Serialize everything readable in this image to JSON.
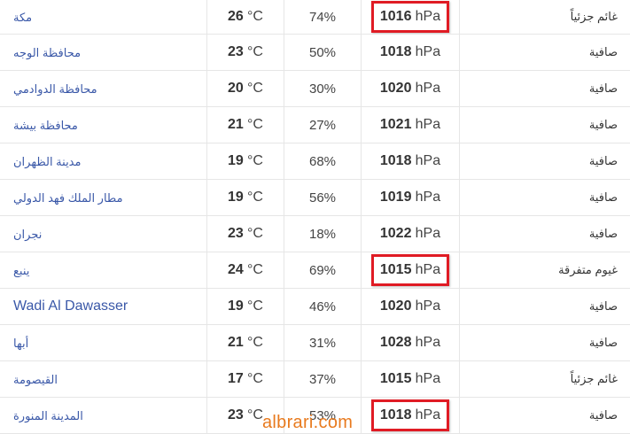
{
  "table": {
    "rows": [
      {
        "city": "مكة",
        "temp": "26",
        "temp_unit": "°C",
        "humidity": "74%",
        "pressure": "1016",
        "pressure_unit": "hPa",
        "condition": "غائم جزئياً",
        "highlighted": true
      },
      {
        "city": "محافظة الوجه",
        "temp": "23",
        "temp_unit": "°C",
        "humidity": "50%",
        "pressure": "1018",
        "pressure_unit": "hPa",
        "condition": "صافية",
        "highlighted": false
      },
      {
        "city": "محافظة الدوادمي",
        "temp": "20",
        "temp_unit": "°C",
        "humidity": "30%",
        "pressure": "1020",
        "pressure_unit": "hPa",
        "condition": "صافية",
        "highlighted": false
      },
      {
        "city": "محافظة بيشة",
        "temp": "21",
        "temp_unit": "°C",
        "humidity": "27%",
        "pressure": "1021",
        "pressure_unit": "hPa",
        "condition": "صافية",
        "highlighted": false
      },
      {
        "city": "مدينة الظهران",
        "temp": "19",
        "temp_unit": "°C",
        "humidity": "68%",
        "pressure": "1018",
        "pressure_unit": "hPa",
        "condition": "صافية",
        "highlighted": false
      },
      {
        "city": "مطار الملك فهد الدولي",
        "temp": "19",
        "temp_unit": "°C",
        "humidity": "56%",
        "pressure": "1019",
        "pressure_unit": "hPa",
        "condition": "صافية",
        "highlighted": false
      },
      {
        "city": "نجران",
        "temp": "23",
        "temp_unit": "°C",
        "humidity": "18%",
        "pressure": "1022",
        "pressure_unit": "hPa",
        "condition": "صافية",
        "highlighted": false
      },
      {
        "city": "ينبع",
        "temp": "24",
        "temp_unit": "°C",
        "humidity": "69%",
        "pressure": "1015",
        "pressure_unit": "hPa",
        "condition": "غيوم متفرقة",
        "highlighted": true
      },
      {
        "city": "Wadi Al Dawasser",
        "temp": "19",
        "temp_unit": "°C",
        "humidity": "46%",
        "pressure": "1020",
        "pressure_unit": "hPa",
        "condition": "صافية",
        "highlighted": false
      },
      {
        "city": "أبها",
        "temp": "21",
        "temp_unit": "°C",
        "humidity": "31%",
        "pressure": "1028",
        "pressure_unit": "hPa",
        "condition": "صافية",
        "highlighted": false
      },
      {
        "city": "القيصومة",
        "temp": "17",
        "temp_unit": "°C",
        "humidity": "37%",
        "pressure": "1015",
        "pressure_unit": "hPa",
        "condition": "غائم جزئياً",
        "highlighted": false
      },
      {
        "city": "المدينة المنورة",
        "temp": "23",
        "temp_unit": "°C",
        "humidity": "53%",
        "pressure": "1018",
        "pressure_unit": "hPa",
        "condition": "صافية",
        "highlighted": true
      }
    ]
  },
  "watermark": {
    "text": "albrari.com"
  },
  "colors": {
    "link": "#3a58a8",
    "highlight_border": "#e01b24",
    "watermark": "#e87a1e",
    "grid": "#e6e6e6"
  }
}
